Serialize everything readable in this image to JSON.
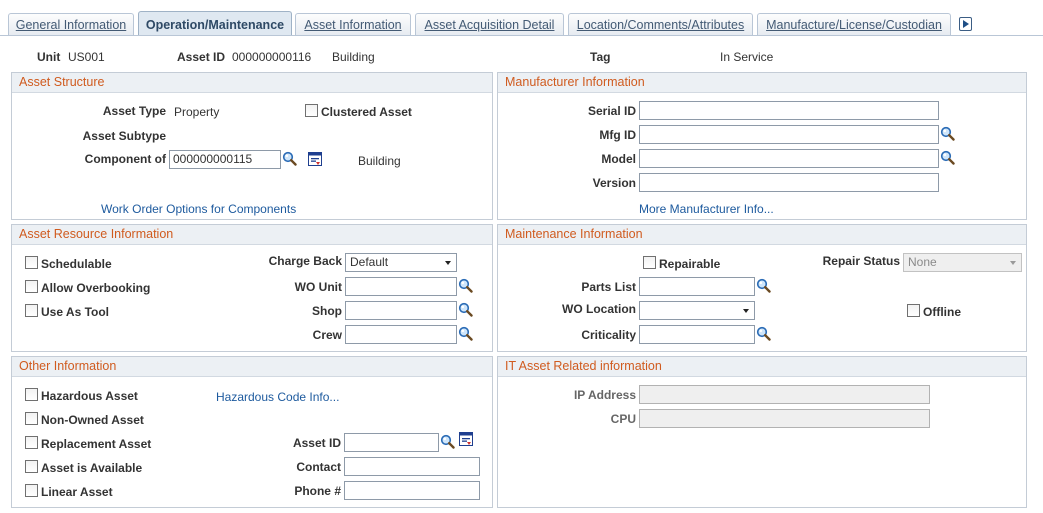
{
  "tabs": [
    {
      "label": "General Information",
      "active": false
    },
    {
      "label": "Operation/Maintenance",
      "active": true
    },
    {
      "label": "Asset Information",
      "active": false
    },
    {
      "label": "Asset Acquisition Detail",
      "active": false
    },
    {
      "label": "Location/Comments/Attributes",
      "active": false
    },
    {
      "label": "Manufacture/License/Custodian",
      "active": false
    }
  ],
  "header": {
    "unit_label": "Unit",
    "unit_value": "US001",
    "asset_id_label": "Asset ID",
    "asset_id_value": "000000000116",
    "asset_desc": "Building",
    "tag_label": "Tag",
    "status": "In Service"
  },
  "asset_structure": {
    "title": "Asset Structure",
    "asset_type_label": "Asset Type",
    "asset_type_value": "Property",
    "clustered_label": "Clustered Asset",
    "subtype_label": "Asset Subtype",
    "component_label": "Component of",
    "component_value": "000000000115",
    "component_desc": "Building",
    "work_order_link": "Work Order Options for Components"
  },
  "manufacturer": {
    "title": "Manufacturer Information",
    "serial_label": "Serial ID",
    "serial_value": "",
    "mfg_label": "Mfg ID",
    "mfg_value": "",
    "model_label": "Model",
    "model_value": "",
    "version_label": "Version",
    "version_value": "",
    "more_link": "More Manufacturer Info..."
  },
  "resource": {
    "title": "Asset Resource Information",
    "schedulable_label": "Schedulable",
    "overbooking_label": "Allow Overbooking",
    "use_as_tool_label": "Use As Tool",
    "charge_back_label": "Charge Back",
    "charge_back_value": "Default",
    "wo_unit_label": "WO Unit",
    "wo_unit_value": "",
    "shop_label": "Shop",
    "shop_value": "",
    "crew_label": "Crew",
    "crew_value": ""
  },
  "maintenance": {
    "title": "Maintenance Information",
    "repairable_label": "Repairable",
    "repair_status_label": "Repair Status",
    "repair_status_value": "None",
    "parts_list_label": "Parts List",
    "parts_list_value": "",
    "wo_location_label": "WO Location",
    "wo_location_value": "",
    "offline_label": "Offline",
    "criticality_label": "Criticality",
    "criticality_value": ""
  },
  "other": {
    "title": "Other Information",
    "hazardous_label": "Hazardous Asset",
    "hazardous_link": "Hazardous Code Info...",
    "non_owned_label": "Non-Owned Asset",
    "replacement_label": "Replacement Asset",
    "available_label": "Asset is Available",
    "linear_label": "Linear Asset",
    "asset_id_label": "Asset ID",
    "asset_id_value": "",
    "contact_label": "Contact",
    "contact_value": "",
    "phone_label": "Phone #",
    "phone_value": ""
  },
  "it_asset": {
    "title": "IT Asset Related information",
    "ip_label": "IP Address",
    "ip_value": "",
    "cpu_label": "CPU",
    "cpu_value": ""
  },
  "icons": {
    "lookup": "magnifier-icon",
    "prompt": "related-page-icon",
    "next_tab": "next-tab-arrow-icon"
  },
  "colors": {
    "section_title": "#d05b1f",
    "link": "#1d5a9e",
    "tab_text": "#435a74",
    "section_header_bg": "#ecf0f4"
  }
}
